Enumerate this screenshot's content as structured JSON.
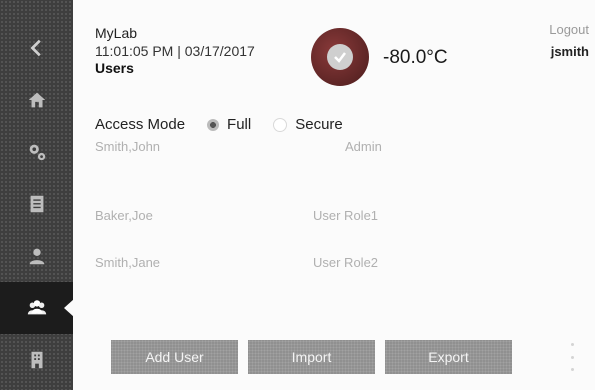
{
  "header": {
    "app_title": "MyLab",
    "datetime": "11:01:05 PM | 03/17/2017",
    "page_title": "Users",
    "temperature": "-80.0°C",
    "logout_label": "Logout",
    "username": "jsmith"
  },
  "sidebar": {
    "items": [
      {
        "icon": "back-icon"
      },
      {
        "icon": "home-icon"
      },
      {
        "icon": "settings-icon"
      },
      {
        "icon": "document-icon"
      },
      {
        "icon": "person-icon"
      },
      {
        "icon": "users-icon",
        "active": true
      },
      {
        "icon": "building-icon"
      }
    ]
  },
  "access_mode": {
    "label": "Access Mode",
    "options": [
      {
        "label": "Full",
        "selected": true
      },
      {
        "label": "Secure",
        "selected": false
      }
    ]
  },
  "users": [
    {
      "name": "Smith,John",
      "role": "Admin"
    },
    {
      "name": "Baker,Joe",
      "role": "User Role1"
    },
    {
      "name": "Smith,Jane",
      "role": "User Role2"
    }
  ],
  "buttons": {
    "add_user": "Add User",
    "import": "Import",
    "export": "Export"
  },
  "colors": {
    "sidebar_bg": "#3e3e3e",
    "status_circle": "#6b2a2a",
    "button_bg": "#909090"
  }
}
